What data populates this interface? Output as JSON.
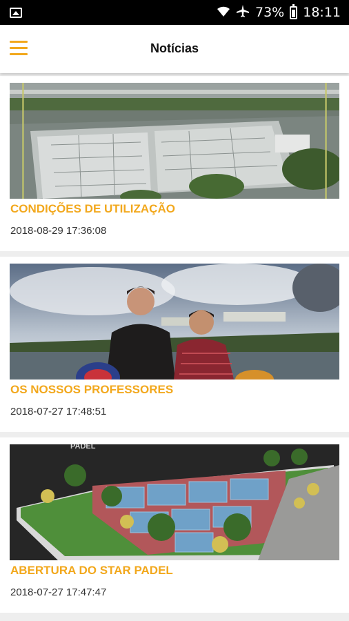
{
  "status_bar": {
    "battery_percent": "73%",
    "time": "18:11",
    "icons": [
      "photo-icon",
      "wifi-icon",
      "airplane-mode-icon",
      "battery-icon"
    ]
  },
  "app_bar": {
    "title": "Notícias",
    "menu_icon": "hamburger-menu-icon",
    "accent_color": "#f2a81d"
  },
  "news": [
    {
      "title": "CONDIÇÕES DE UTILIZAÇÃO",
      "date": "2018-08-29 17:36:08",
      "image": "aerial photo of padel club courts"
    },
    {
      "title": "OS NOSSOS PROFESSORES",
      "date": "2018-07-27 17:48:51",
      "image": "two padel instructors holding rackets by the river"
    },
    {
      "title": "ABERTURA DO STAR PADEL",
      "date": "2018-07-27 17:47:47",
      "image": "3D render of Star Padel courts"
    }
  ],
  "image_caption_fragment": "PADEL"
}
